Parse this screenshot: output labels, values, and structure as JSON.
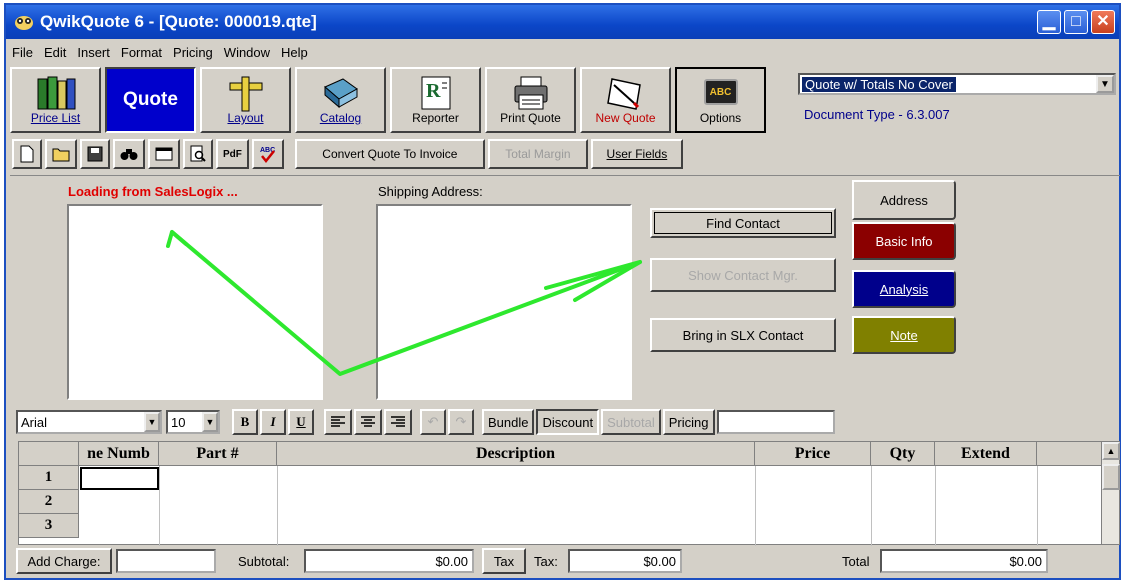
{
  "window": {
    "title": "QwikQuote 6 - [Quote: 000019.qte]"
  },
  "menu": [
    "File",
    "Edit",
    "Insert",
    "Format",
    "Pricing",
    "Window",
    "Help"
  ],
  "main_toolbar": {
    "price_list": "Price List",
    "quote": "Quote",
    "layout": "Layout",
    "catalog": "Catalog",
    "reporter": "Reporter",
    "print_quote": "Print Quote",
    "new_quote": "New Quote",
    "options": "Options",
    "options_icon_text": "ABC"
  },
  "document": {
    "template_selected": "Quote w/ Totals No Cover",
    "type_label": "Document Type - 6.3.007"
  },
  "secondary_toolbar": {
    "pdf": "PdF",
    "convert": "Convert Quote To Invoice",
    "total_margin": "Total Margin",
    "user_fields": "User Fields"
  },
  "address_panel": {
    "loading_text": "Loading from SalesLogix ...",
    "shipping_label": "Shipping Address:",
    "find_contact": "Find Contact",
    "show_contact_mgr": "Show Contact Mgr.",
    "bring_in_slx": "Bring in SLX Contact"
  },
  "tabs": {
    "address": "Address",
    "basic_info": "Basic Info",
    "analysis": "Analysis",
    "note": "Note",
    "colors": {
      "basic_info": "#8b0000",
      "analysis": "#00008b",
      "note": "#808000"
    }
  },
  "format_toolbar": {
    "font": "Arial",
    "size": "10",
    "bold": "B",
    "italic": "I",
    "underline": "U",
    "bundle": "Bundle",
    "discount": "Discount",
    "subtotal": "Subtotal",
    "pricing": "Pricing",
    "pricing_field": ""
  },
  "grid": {
    "columns": [
      "ne Numb",
      "Part #",
      "Description",
      "Price",
      "Qty",
      "Extend"
    ],
    "rows": [
      "1",
      "2",
      "3"
    ]
  },
  "footer": {
    "add_charge": "Add Charge:",
    "add_charge_value": "",
    "subtotal_label": "Subtotal:",
    "subtotal_value": "$0.00",
    "tax_button": "Tax",
    "tax_label": "Tax:",
    "tax_value": "$0.00",
    "total_label": "Total",
    "total_value": "$0.00"
  },
  "annotation": {
    "arrow_color": "#2ee82e"
  }
}
